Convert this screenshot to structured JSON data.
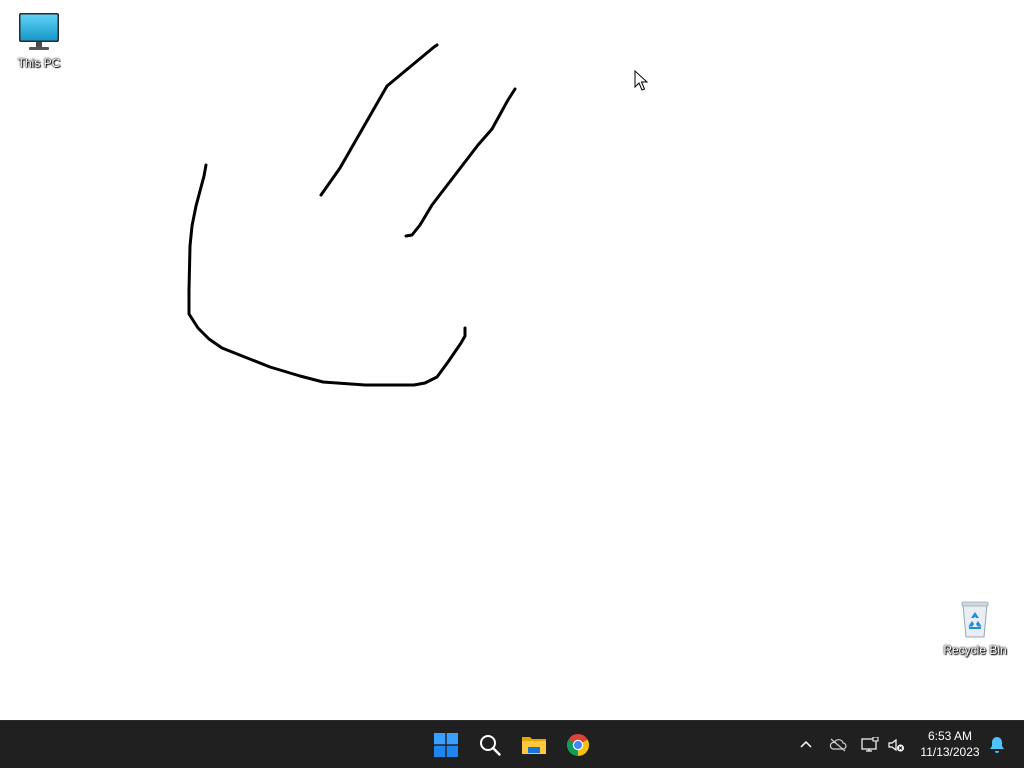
{
  "desktop": {
    "icons": [
      {
        "label": "This PC",
        "icon": "monitor-icon"
      },
      {
        "label": "Recycle Bin",
        "icon": "recycle-bin-icon"
      }
    ],
    "canvas": {
      "content": "freehand-black-strokes",
      "stroke_color": "#000000"
    }
  },
  "taskbar": {
    "background": "#202020",
    "pinned": [
      {
        "name": "Start",
        "icon": "windows-start-icon"
      },
      {
        "name": "Search",
        "icon": "search-icon"
      },
      {
        "name": "File Explorer",
        "icon": "folder-icon"
      },
      {
        "name": "Google Chrome",
        "icon": "chrome-icon"
      }
    ],
    "tray": {
      "icons": [
        "chevron-up-icon",
        "onedrive-off-icon",
        "network-icon",
        "volume-muted-icon",
        "notification-bell-icon"
      ],
      "time": "6:53 AM",
      "date": "11/13/2023"
    },
    "accent_color": "#1e90ff"
  }
}
